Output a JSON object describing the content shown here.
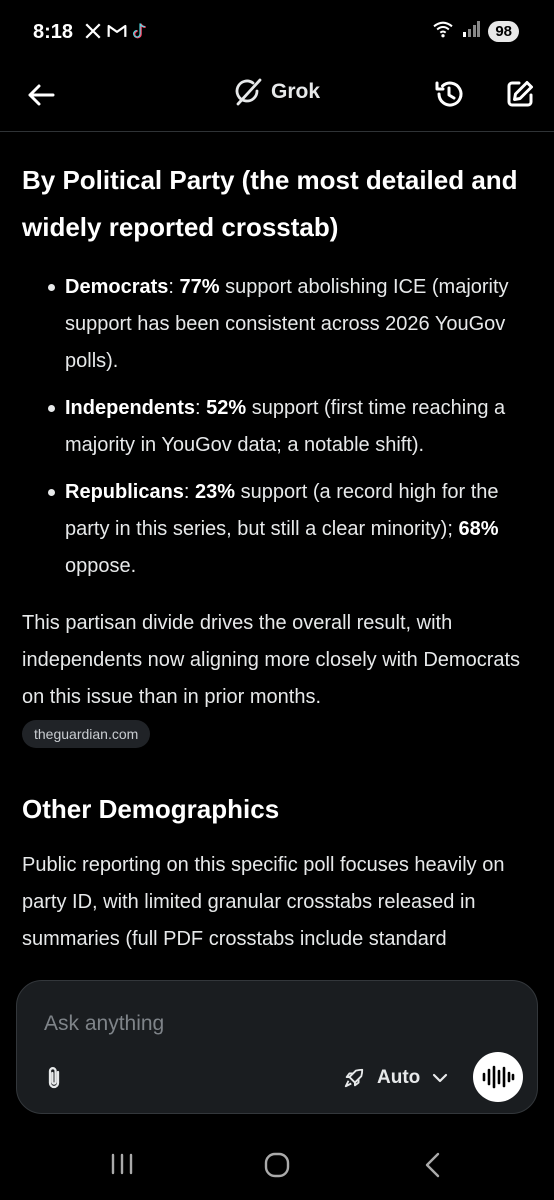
{
  "status_bar": {
    "time": "8:18",
    "notif_icons": [
      "x-logo-icon",
      "gmail-icon",
      "tiktok-icon"
    ],
    "battery": "98"
  },
  "header": {
    "app_name": "Grok",
    "back_icon": "arrow-left-icon",
    "history_icon": "history-icon",
    "new_chat_icon": "edit-icon"
  },
  "content": {
    "heading_party": "By Political Party (the most detailed and widely reported crosstab)",
    "bullets": [
      {
        "label": "Democrats",
        "sep": ": ",
        "stat": "77%",
        "text": " support abolishing ICE (majority support has been consistent across 2026 YouGov polls)."
      },
      {
        "label": "Independents",
        "sep": ": ",
        "stat": "52%",
        "text": " support (first time reaching a majority in YouGov data; a notable shift)."
      },
      {
        "label": "Republicans",
        "sep": ": ",
        "stat": "23%",
        "text": " support (a record high for the party in this series, but still a clear minority); ",
        "stat2": "68%",
        "text2": " oppose."
      }
    ],
    "paragraph_divide": "This partisan divide drives the overall result, with independents now aligning more closely with Democrats on this issue than in prior months.",
    "source_chip": "theguardian.com",
    "heading_demographics": "Other Demographics",
    "paragraph_public": "Public reporting on this specific poll focuses heavily on party ID, with limited granular crosstabs released in summaries (full PDF crosstabs include standard"
  },
  "composer": {
    "placeholder": "Ask anything",
    "mode_label": "Auto",
    "attach_icon": "paperclip-icon",
    "mode_icon": "rocket-icon",
    "voice_icon": "voice-waveform-icon"
  },
  "nav_bar": {
    "icons": [
      "recents-icon",
      "home-icon",
      "back-nav-icon"
    ]
  },
  "colors": {
    "background": "#000000",
    "text": "#e7e9ea",
    "composer_bg": "#1a1d20",
    "chip_bg": "#202327"
  }
}
